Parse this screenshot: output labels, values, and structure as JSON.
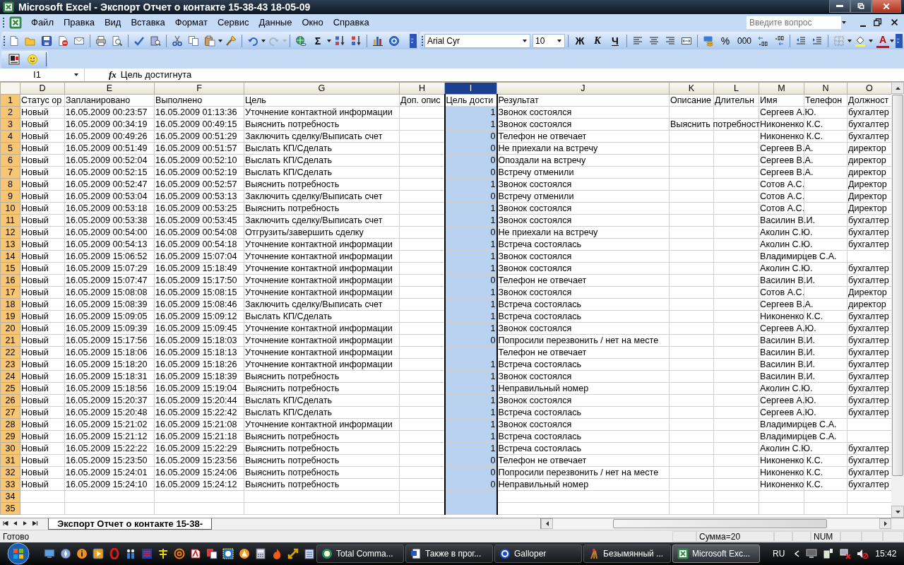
{
  "window": {
    "title": "Microsoft Excel - Экспорт Отчет о контакте 15-38-43 18-05-09"
  },
  "menu": [
    "Файл",
    "Правка",
    "Вид",
    "Вставка",
    "Формат",
    "Сервис",
    "Данные",
    "Окно",
    "Справка"
  ],
  "help_search": {
    "placeholder": "Введите вопрос"
  },
  "standard_toolbar": {
    "autosum": "Σ"
  },
  "formatting_toolbar": {
    "font": "Arial Cyr",
    "size": "10",
    "bold": "Ж",
    "italic": "К",
    "underline": "Ч",
    "percent": "%",
    "thousands": "000",
    "font_color": "A"
  },
  "formula_bar": {
    "name_box": "I1",
    "function_label": "fx",
    "formula": "Цель достигнута"
  },
  "sheet": {
    "columns": [
      {
        "letter": "D",
        "selected": false,
        "numeric": false
      },
      {
        "letter": "E",
        "selected": false,
        "numeric": false
      },
      {
        "letter": "F",
        "selected": false,
        "numeric": false
      },
      {
        "letter": "G",
        "selected": false,
        "numeric": false
      },
      {
        "letter": "H",
        "selected": false,
        "numeric": false
      },
      {
        "letter": "I",
        "selected": true,
        "numeric": true
      },
      {
        "letter": "J",
        "selected": false,
        "numeric": false
      },
      {
        "letter": "K",
        "selected": false,
        "numeric": false
      },
      {
        "letter": "L",
        "selected": false,
        "numeric": false
      },
      {
        "letter": "M",
        "selected": false,
        "numeric": false
      },
      {
        "letter": "N",
        "selected": false,
        "numeric": false
      },
      {
        "letter": "O",
        "selected": false,
        "numeric": false
      }
    ],
    "rows": [
      {
        "number": "1",
        "cells": [
          "Статус ор",
          "Запланировано",
          "Выполнено",
          "Цель",
          "Доп. опис",
          "Цель дости",
          "Результат",
          "Описание",
          "Длительн",
          "Имя",
          "Телефон",
          "Должност"
        ]
      },
      {
        "number": "2",
        "cells": [
          "Новый",
          "16.05.2009 00:23:57",
          "16.05.2009 01:13:36",
          "Уточнение контактной информации",
          null,
          "1",
          "Звонок состоялся",
          null,
          null,
          "Сергеев А.Ю.",
          null,
          "бухгалтер"
        ]
      },
      {
        "number": "3",
        "cells": [
          "Новый",
          "16.05.2009 00:34:19",
          "16.05.2009 00:49:15",
          "Выяснить потребность",
          null,
          "1",
          "Звонок состоялся",
          "Выяснить потребност",
          null,
          "Никоненко К.С.",
          null,
          "бухгалтер"
        ]
      },
      {
        "number": "4",
        "cells": [
          "Новый",
          "16.05.2009 00:49:26",
          "16.05.2009 00:51:29",
          "Заключить сделку/Выписать счет",
          null,
          "0",
          "Телефон не отвечает",
          null,
          null,
          "Никоненко К.С.",
          null,
          "бухгалтер"
        ]
      },
      {
        "number": "5",
        "cells": [
          "Новый",
          "16.05.2009 00:51:49",
          "16.05.2009 00:51:57",
          "Выслать КП/Сделать",
          null,
          "0",
          "Не приехали на встречу",
          null,
          null,
          "Сергеев В.А.",
          null,
          "директор"
        ]
      },
      {
        "number": "6",
        "cells": [
          "Новый",
          "16.05.2009 00:52:04",
          "16.05.2009 00:52:10",
          "Выслать КП/Сделать",
          null,
          "0",
          "Опоздали на встречу",
          null,
          null,
          "Сергеев В.А.",
          null,
          "директор"
        ]
      },
      {
        "number": "7",
        "cells": [
          "Новый",
          "16.05.2009 00:52:15",
          "16.05.2009 00:52:19",
          "Выслать КП/Сделать",
          null,
          "0",
          "Встречу отменили",
          null,
          null,
          "Сергеев В.А.",
          null,
          "директор"
        ]
      },
      {
        "number": "8",
        "cells": [
          "Новый",
          "16.05.2009 00:52:47",
          "16.05.2009 00:52:57",
          "Выяснить потребность",
          null,
          "1",
          "Звонок состоялся",
          null,
          null,
          "Сотов А.С.",
          null,
          "Директор"
        ]
      },
      {
        "number": "9",
        "cells": [
          "Новый",
          "16.05.2009 00:53:04",
          "16.05.2009 00:53:13",
          "Заключить сделку/Выписать счет",
          null,
          "0",
          "Встречу отменили",
          null,
          null,
          "Сотов А.С.",
          null,
          "Директор"
        ]
      },
      {
        "number": "10",
        "cells": [
          "Новый",
          "16.05.2009 00:53:18",
          "16.05.2009 00:53:25",
          "Выяснить потребность",
          null,
          "1",
          "Звонок состоялся",
          null,
          null,
          "Сотов А.С.",
          null,
          "Директор"
        ]
      },
      {
        "number": "11",
        "cells": [
          "Новый",
          "16.05.2009 00:53:38",
          "16.05.2009 00:53:45",
          "Заключить сделку/Выписать счет",
          null,
          "1",
          "Звонок состоялся",
          null,
          null,
          "Василин В.И.",
          null,
          "бухгалтер"
        ]
      },
      {
        "number": "12",
        "cells": [
          "Новый",
          "16.05.2009 00:54:00",
          "16.05.2009 00:54:08",
          "Отгрузить/завершить сделку",
          null,
          "0",
          "Не приехали на встречу",
          null,
          null,
          "Аколин С.Ю.",
          null,
          "бухгалтер"
        ]
      },
      {
        "number": "13",
        "cells": [
          "Новый",
          "16.05.2009 00:54:13",
          "16.05.2009 00:54:18",
          "Уточнение контактной информации",
          null,
          "1",
          "Встреча состоялась",
          null,
          null,
          "Аколин С.Ю.",
          null,
          "бухгалтер"
        ]
      },
      {
        "number": "14",
        "cells": [
          "Новый",
          "16.05.2009 15:06:52",
          "16.05.2009 15:07:04",
          "Уточнение контактной информации",
          null,
          "1",
          "Звонок состоялся",
          null,
          null,
          "Владимирцев С.А.",
          null,
          null
        ]
      },
      {
        "number": "15",
        "cells": [
          "Новый",
          "16.05.2009 15:07:29",
          "16.05.2009 15:18:49",
          "Уточнение контактной информации",
          null,
          "1",
          "Звонок состоялся",
          null,
          null,
          "Аколин С.Ю.",
          null,
          "бухгалтер"
        ]
      },
      {
        "number": "16",
        "cells": [
          "Новый",
          "16.05.2009 15:07:47",
          "16.05.2009 15:17:50",
          "Уточнение контактной информации",
          null,
          "0",
          "Телефон не отвечает",
          null,
          null,
          "Василин В.И.",
          null,
          "бухгалтер"
        ]
      },
      {
        "number": "17",
        "cells": [
          "Новый",
          "16.05.2009 15:08:08",
          "16.05.2009 15:08:15",
          "Уточнение контактной информации",
          null,
          "1",
          "Звонок состоялся",
          null,
          null,
          "Сотов А.С.",
          null,
          "Директор"
        ]
      },
      {
        "number": "18",
        "cells": [
          "Новый",
          "16.05.2009 15:08:39",
          "16.05.2009 15:08:46",
          "Заключить сделку/Выписать счет",
          null,
          "1",
          "Встреча состоялась",
          null,
          null,
          "Сергеев В.А.",
          null,
          "директор"
        ]
      },
      {
        "number": "19",
        "cells": [
          "Новый",
          "16.05.2009 15:09:05",
          "16.05.2009 15:09:12",
          "Выслать КП/Сделать",
          null,
          "1",
          "Встреча состоялась",
          null,
          null,
          "Никоненко К.С.",
          null,
          "бухгалтер"
        ]
      },
      {
        "number": "20",
        "cells": [
          "Новый",
          "16.05.2009 15:09:39",
          "16.05.2009 15:09:45",
          "Уточнение контактной информации",
          null,
          "1",
          "Звонок состоялся",
          null,
          null,
          "Сергеев А.Ю.",
          null,
          "бухгалтер"
        ]
      },
      {
        "number": "21",
        "cells": [
          "Новый",
          "16.05.2009 15:17:56",
          "16.05.2009 15:18:03",
          "Уточнение контактной информации",
          null,
          "0",
          "Попросили перезвонить / нет на месте",
          null,
          null,
          "Василин В.И.",
          null,
          "бухгалтер"
        ]
      },
      {
        "number": "22",
        "cells": [
          "Новый",
          "16.05.2009 15:18:06",
          "16.05.2009 15:18:13",
          "Уточнение контактной информации",
          null,
          null,
          "Телефон не отвечает",
          null,
          null,
          "Василин В.И.",
          null,
          "бухгалтер"
        ]
      },
      {
        "number": "23",
        "cells": [
          "Новый",
          "16.05.2009 15:18:20",
          "16.05.2009 15:18:26",
          "Уточнение контактной информации",
          null,
          "1",
          "Встреча состоялась",
          null,
          null,
          "Василин В.И.",
          null,
          "бухгалтер"
        ]
      },
      {
        "number": "24",
        "cells": [
          "Новый",
          "16.05.2009 15:18:31",
          "16.05.2009 15:18:39",
          "Выяснить потребность",
          null,
          "1",
          "Звонок состоялся",
          null,
          null,
          "Василин В.И.",
          null,
          "бухгалтер"
        ]
      },
      {
        "number": "25",
        "cells": [
          "Новый",
          "16.05.2009 15:18:56",
          "16.05.2009 15:19:04",
          "Выяснить потребность",
          null,
          "1",
          "Неправильный номер",
          null,
          null,
          "Аколин С.Ю.",
          null,
          "бухгалтер"
        ]
      },
      {
        "number": "26",
        "cells": [
          "Новый",
          "16.05.2009 15:20:37",
          "16.05.2009 15:20:44",
          "Выслать КП/Сделать",
          null,
          "1",
          "Звонок состоялся",
          null,
          null,
          "Сергеев А.Ю.",
          null,
          "бухгалтер"
        ]
      },
      {
        "number": "27",
        "cells": [
          "Новый",
          "16.05.2009 15:20:48",
          "16.05.2009 15:22:42",
          "Выслать КП/Сделать",
          null,
          "1",
          "Встреча состоялась",
          null,
          null,
          "Сергеев А.Ю.",
          null,
          "бухгалтер"
        ]
      },
      {
        "number": "28",
        "cells": [
          "Новый",
          "16.05.2009 15:21:02",
          "16.05.2009 15:21:08",
          "Уточнение контактной информации",
          null,
          "1",
          "Звонок состоялся",
          null,
          null,
          "Владимирцев С.А.",
          null,
          null
        ]
      },
      {
        "number": "29",
        "cells": [
          "Новый",
          "16.05.2009 15:21:12",
          "16.05.2009 15:21:18",
          "Выяснить потребность",
          null,
          "1",
          "Встреча состоялась",
          null,
          null,
          "Владимирцев С.А.",
          null,
          null
        ]
      },
      {
        "number": "30",
        "cells": [
          "Новый",
          "16.05.2009 15:22:22",
          "16.05.2009 15:22:29",
          "Выяснить потребность",
          null,
          "1",
          "Встреча состоялась",
          null,
          null,
          "Аколин С.Ю.",
          null,
          "бухгалтер"
        ]
      },
      {
        "number": "31",
        "cells": [
          "Новый",
          "16.05.2009 15:23:50",
          "16.05.2009 15:23:56",
          "Выяснить потребность",
          null,
          "0",
          "Телефон не отвечает",
          null,
          null,
          "Никоненко К.С.",
          null,
          "бухгалтер"
        ]
      },
      {
        "number": "32",
        "cells": [
          "Новый",
          "16.05.2009 15:24:01",
          "16.05.2009 15:24:06",
          "Выяснить потребность",
          null,
          "0",
          "Попросили перезвонить / нет на месте",
          null,
          null,
          "Никоненко К.С.",
          null,
          "бухгалтер"
        ]
      },
      {
        "number": "33",
        "cells": [
          "Новый",
          "16.05.2009 15:24:10",
          "16.05.2009 15:24:12",
          "Выяснить потребность",
          null,
          "0",
          "Неправильный номер",
          null,
          null,
          "Никоненко К.С.",
          null,
          "бухгалтер"
        ]
      },
      {
        "number": "34"
      },
      {
        "number": "35"
      }
    ]
  },
  "sheet_tabs": [
    {
      "label": "Экспорт Отчет о контакте 15-38-",
      "selected": true
    }
  ],
  "status_bar": {
    "mode": "Готово",
    "sum": "Сумма=20",
    "num_lock": "NUM"
  },
  "taskbar": {
    "windows": [
      {
        "label": "Total Comma...",
        "selected": false
      },
      {
        "label": "Также в прог...",
        "selected": false
      },
      {
        "label": "Galloper",
        "selected": false
      },
      {
        "label": "Безымянный ...",
        "selected": false
      },
      {
        "label": "Microsoft Exc...",
        "selected": true
      }
    ],
    "language": "RU",
    "clock": "15:42"
  }
}
